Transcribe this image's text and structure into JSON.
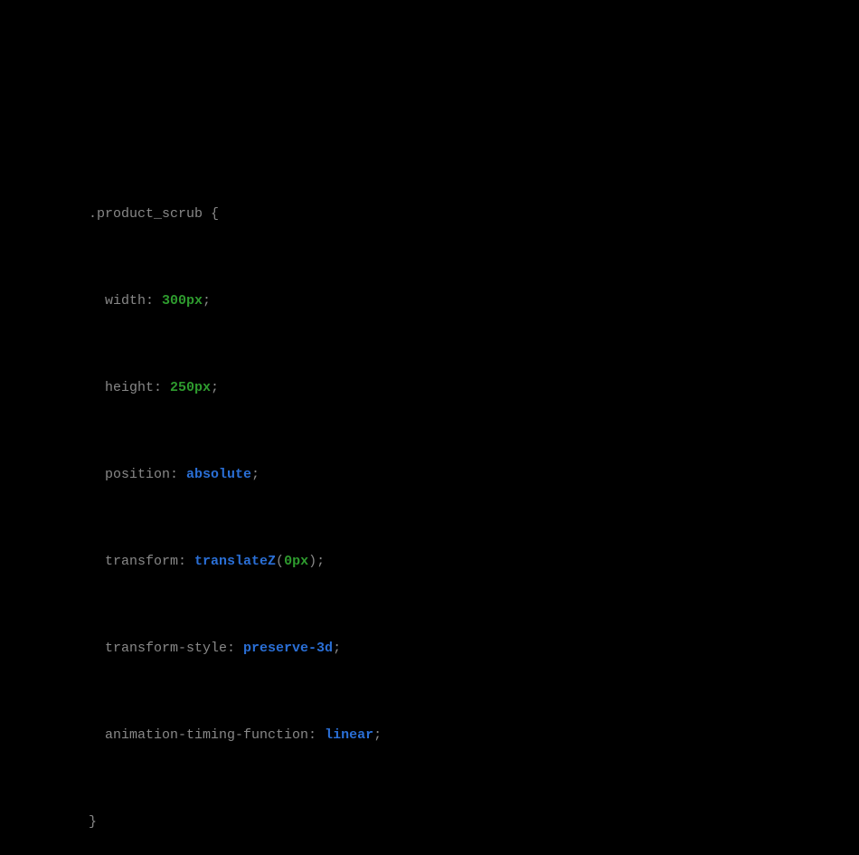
{
  "code": {
    "selector": ".product_scrub",
    "open_brace": " {",
    "close_brace": "}",
    "decls": [
      {
        "prop": "width",
        "value_number": "300px",
        "value_keyword": "",
        "func": "",
        "func_args_number": "",
        "trail": ";"
      },
      {
        "prop": "height",
        "value_number": "250px",
        "value_keyword": "",
        "func": "",
        "func_args_number": "",
        "trail": ";"
      },
      {
        "prop": "position",
        "value_number": "",
        "value_keyword": "absolute",
        "func": "",
        "func_args_number": "",
        "trail": ";"
      },
      {
        "prop": "transform",
        "value_number": "",
        "value_keyword": "",
        "func": "translateZ",
        "func_args_number": "0px",
        "trail": ";"
      },
      {
        "prop": "transform-style",
        "value_number": "",
        "value_keyword": "preserve-3d",
        "func": "",
        "func_args_number": "",
        "trail": ";"
      },
      {
        "prop": "animation-timing-function",
        "value_number": "",
        "value_keyword": "linear",
        "func": "",
        "func_args_number": "",
        "trail": ";"
      }
    ]
  }
}
